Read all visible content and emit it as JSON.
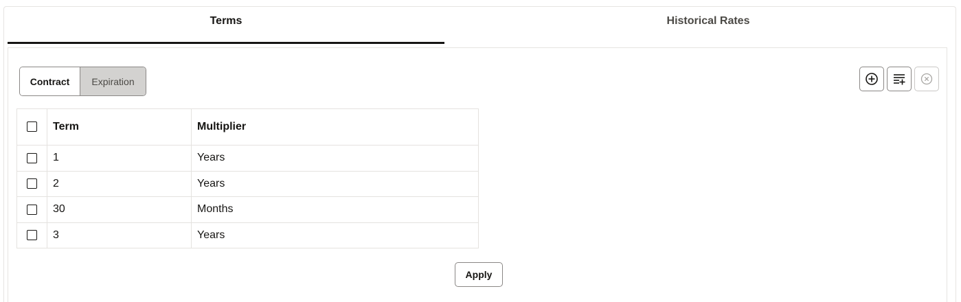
{
  "tabs": [
    {
      "label": "Terms",
      "selected": true
    },
    {
      "label": "Historical Rates",
      "selected": false
    }
  ],
  "segment": {
    "options": [
      "Contract",
      "Expiration"
    ],
    "selected": "Contract"
  },
  "toolbar": {
    "icons": [
      "add-circle-icon",
      "add-row-icon",
      "remove-circle-icon"
    ],
    "remove_disabled": true
  },
  "table": {
    "columns": [
      "Term",
      "Multiplier"
    ],
    "rows": [
      {
        "term": "1",
        "multiplier": "Years"
      },
      {
        "term": "2",
        "multiplier": "Years"
      },
      {
        "term": "30",
        "multiplier": "Months"
      },
      {
        "term": "3",
        "multiplier": "Years"
      }
    ]
  },
  "apply_label": "Apply",
  "colors": {
    "text": "#161513",
    "tab_underline": "#161513",
    "segment_inactive_bg": "#d3d2d0",
    "border": "#8a8785",
    "grid_line": "#e4e2df"
  }
}
